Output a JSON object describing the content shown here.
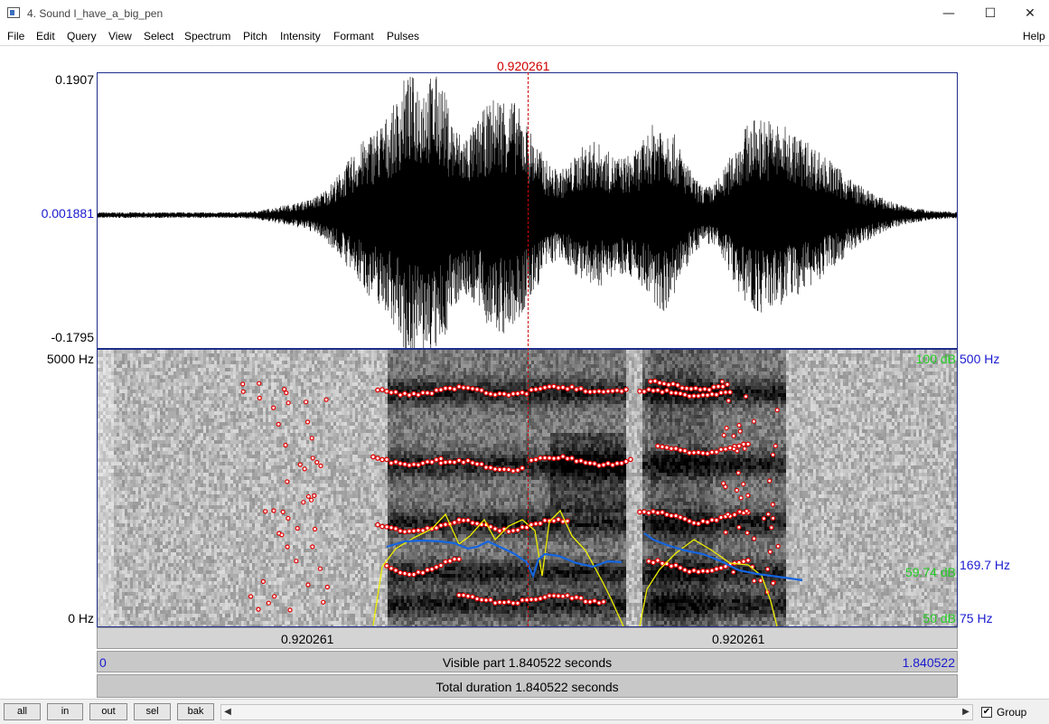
{
  "window": {
    "title": "4. Sound I_have_a_big_pen",
    "minimize": "—",
    "maximize": "☐",
    "close": "✕"
  },
  "menu": {
    "items": [
      "File",
      "Edit",
      "Query",
      "View",
      "Select",
      "Spectrum",
      "Pitch",
      "Intensity",
      "Formant",
      "Pulses"
    ],
    "help": "Help"
  },
  "cursor": {
    "time_label": "0.920261",
    "time_seconds": 0.920261
  },
  "waveform": {
    "max_label": "0.1907",
    "zero_label": "0.001881",
    "min_label": "-0.1795"
  },
  "spectrogram": {
    "freq_top_label": "5000 Hz",
    "freq_bottom_label": "0 Hz",
    "intensity_top_label": "100 dB",
    "intensity_current_label": "59.74 dB",
    "intensity_bottom_label": "50 dB",
    "pitch_top_label": "500 Hz",
    "pitch_current_label": "169.7 Hz",
    "pitch_bottom_label": "75 Hz"
  },
  "time_bar": {
    "left_label": "0.920261",
    "right_label": "0.920261"
  },
  "visible_bar": {
    "start": "0",
    "text": "Visible part 1.840522 seconds",
    "end": "1.840522"
  },
  "total_bar": {
    "text": "Total duration 1.840522 seconds"
  },
  "buttons": {
    "all": "all",
    "in": "in",
    "out": "out",
    "sel": "sel",
    "bak": "bak"
  },
  "scroll": {
    "left_arrow": "◀",
    "right_arrow": "▶"
  },
  "group": {
    "label": "Group",
    "checked": true,
    "check_mark": "✔"
  },
  "colors": {
    "cursor": "#d00000",
    "pitch": "#1565e0",
    "intensity": "#f0f000",
    "formant": "#e00000",
    "axis_blue": "#1a1ad0",
    "axis_green": "#22cc22"
  }
}
